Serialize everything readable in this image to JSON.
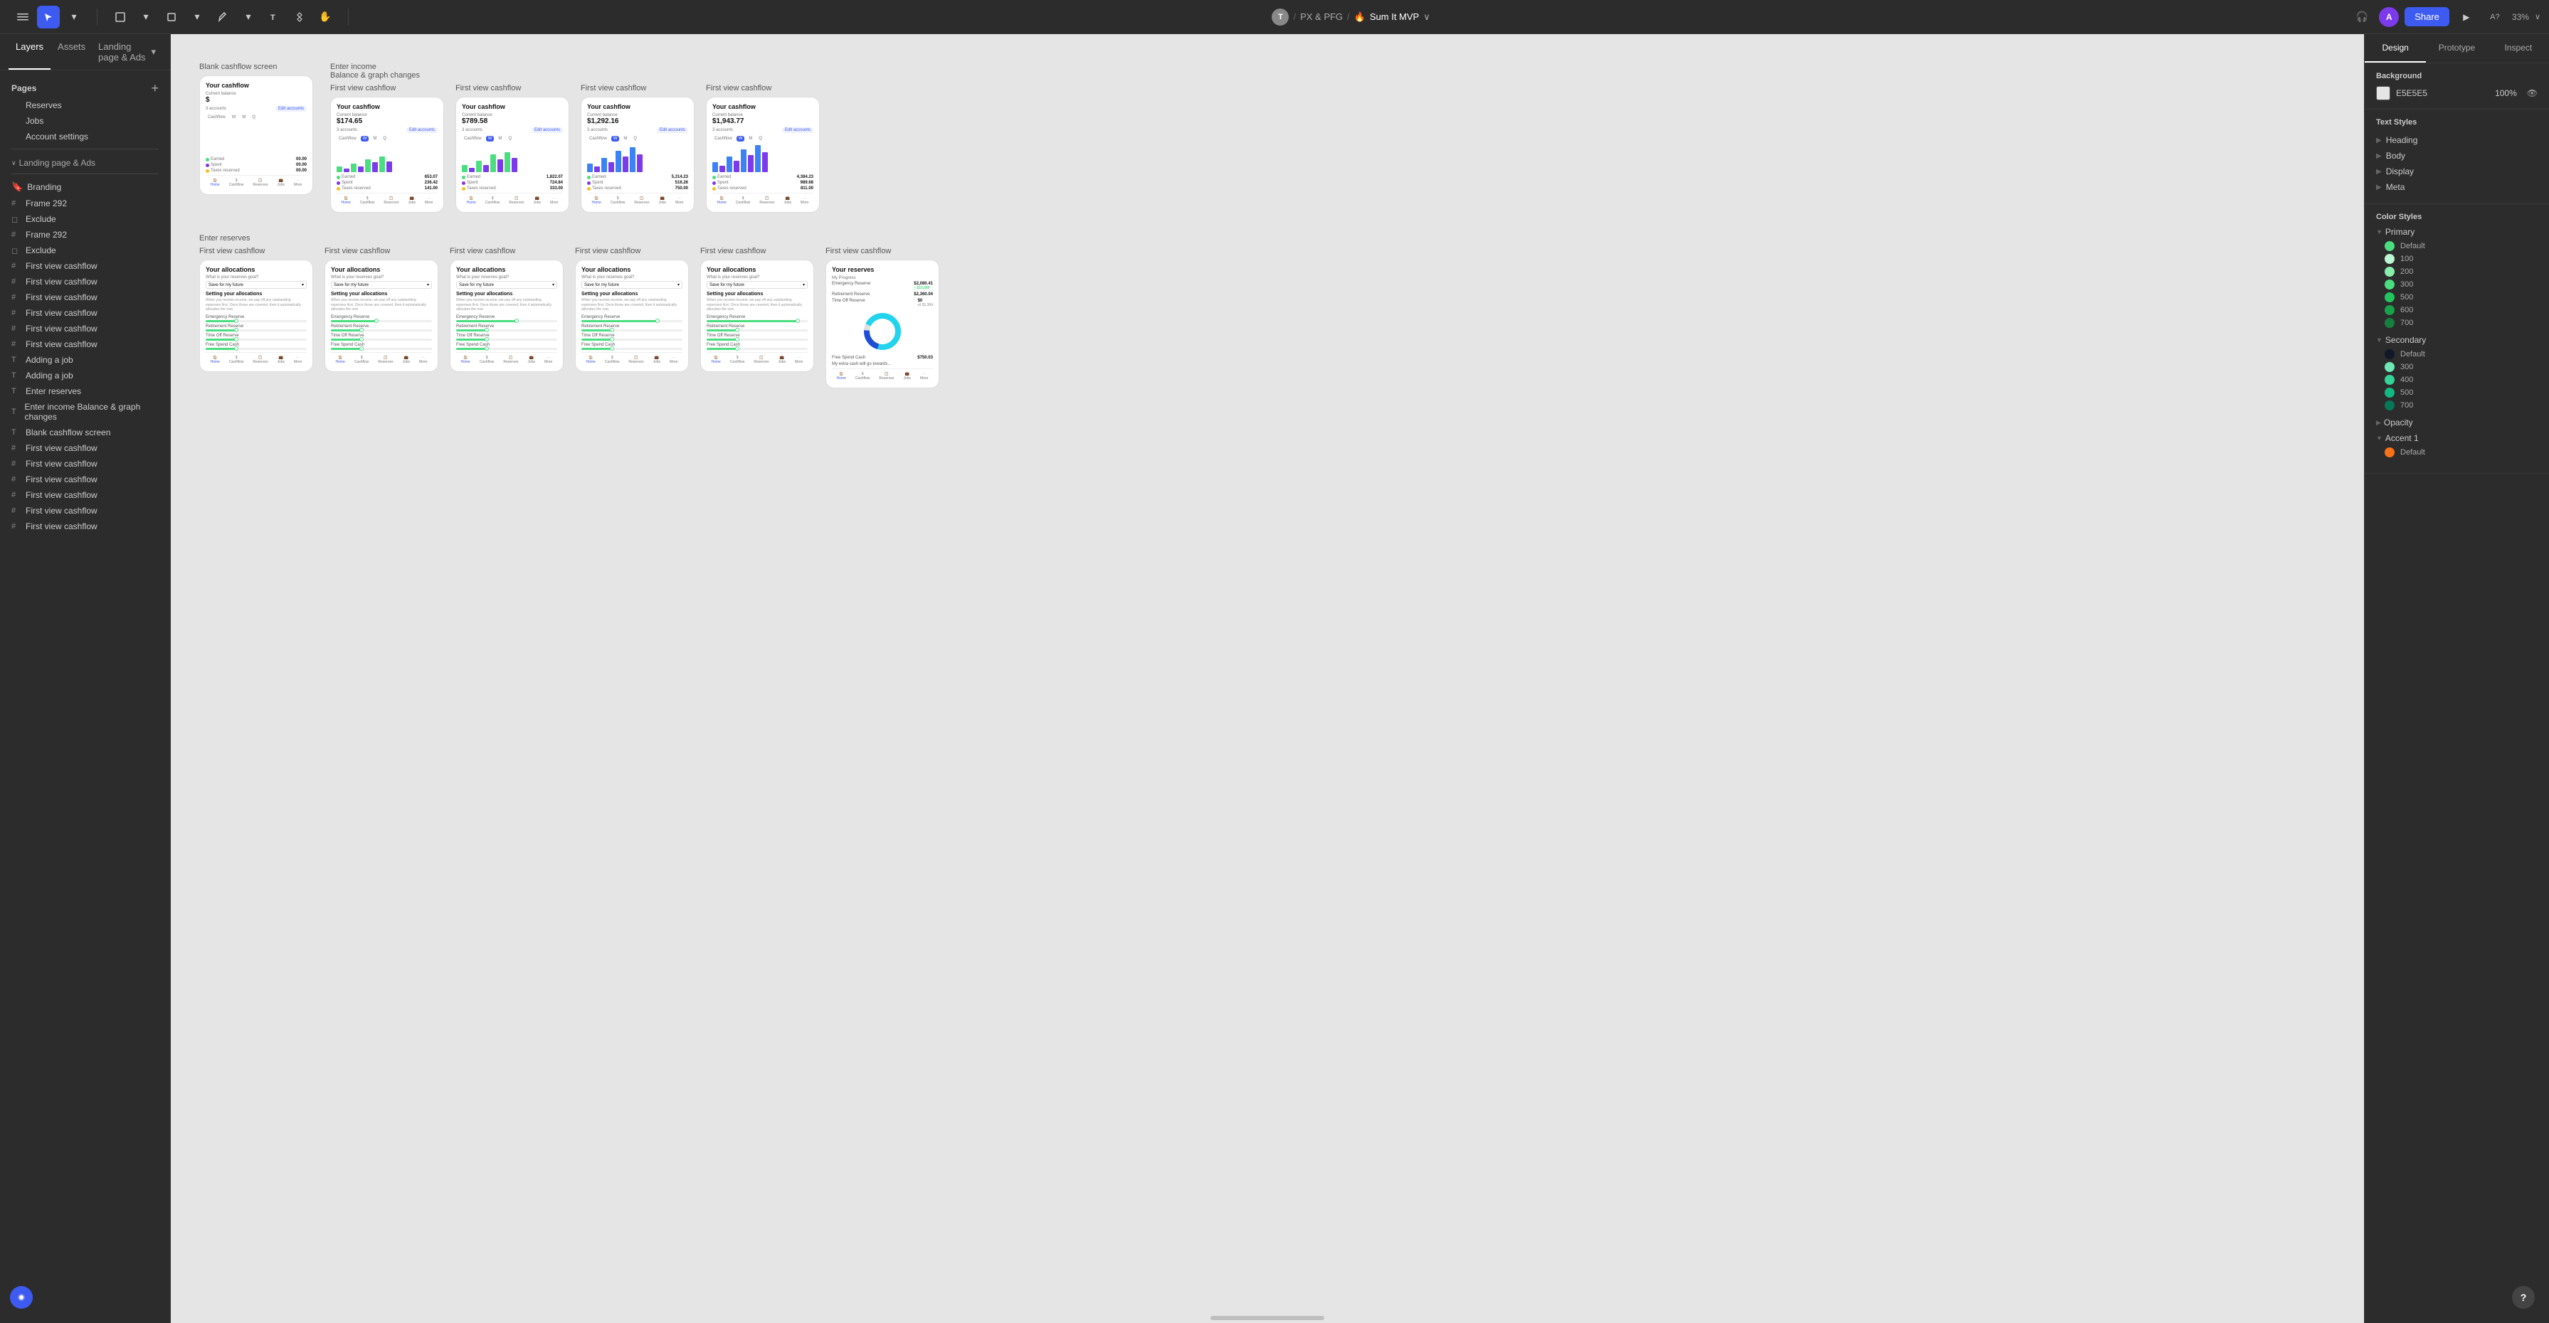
{
  "toolbar": {
    "avatar_initial": "T",
    "breadcrumb_sep": "/",
    "project_prefix": "PX & PFG",
    "fire_emoji": "🔥",
    "project_name": "Sum It MVP",
    "share_label": "Share",
    "play_icon": "▶",
    "zoom": "33%",
    "chevron": "∨"
  },
  "left_panel": {
    "tabs": [
      "Layers",
      "Assets"
    ],
    "page_dropdown": "Landing page & Ads",
    "pages_title": "Pages",
    "pages": [
      {
        "name": "Reserves",
        "icon": ""
      },
      {
        "name": "Jobs",
        "icon": ""
      },
      {
        "name": "Account settings",
        "icon": ""
      }
    ],
    "groups": [
      {
        "name": "Landing page & Ads",
        "expanded": true,
        "items": []
      }
    ],
    "branding": "🔖 Branding",
    "layers": [
      {
        "name": "Frame 292",
        "icon": "#",
        "type": "frame"
      },
      {
        "name": "Exclude",
        "icon": "◻",
        "type": "shape"
      },
      {
        "name": "First view cashflow",
        "icon": "#",
        "type": "frame"
      },
      {
        "name": "First view cashflow",
        "icon": "#",
        "type": "frame"
      },
      {
        "name": "First view cashflow",
        "icon": "#",
        "type": "frame"
      },
      {
        "name": "First view cashflow",
        "icon": "#",
        "type": "frame"
      },
      {
        "name": "First view cashflow",
        "icon": "#",
        "type": "frame"
      },
      {
        "name": "First view cashflow",
        "icon": "#",
        "type": "frame"
      },
      {
        "name": "Adding a job",
        "icon": "T",
        "type": "text"
      },
      {
        "name": "Adding a job",
        "icon": "T",
        "type": "text"
      },
      {
        "name": "Enter reserves",
        "icon": "T",
        "type": "text"
      },
      {
        "name": "Enter income Balance & graph changes",
        "icon": "T",
        "type": "text"
      },
      {
        "name": "Blank cashflow screen",
        "icon": "T",
        "type": "text"
      },
      {
        "name": "First view cashflow",
        "icon": "#",
        "type": "frame"
      },
      {
        "name": "First view cashflow",
        "icon": "#",
        "type": "frame"
      },
      {
        "name": "First view cashflow",
        "icon": "#",
        "type": "frame"
      },
      {
        "name": "First view cashflow",
        "icon": "#",
        "type": "frame"
      },
      {
        "name": "First view cashflow",
        "icon": "#",
        "type": "frame"
      },
      {
        "name": "First view cashflow",
        "icon": "#",
        "type": "frame"
      }
    ]
  },
  "canvas": {
    "row1_label": "Blank cashflow screen",
    "row1_label2": "Enter income\nBalance & graph changes",
    "section1_label": "First view cashflow",
    "frames_row1": [
      {
        "balance_label": "",
        "balance_amount": "$",
        "has_chart": false
      },
      {
        "balance_label": "Current balance",
        "balance_amount": "$174.65",
        "has_chart": true
      },
      {
        "balance_label": "Current balance",
        "balance_amount": "$789.58",
        "has_chart": true
      },
      {
        "balance_label": "Current balance",
        "balance_amount": "$1,292.16",
        "has_chart": true
      },
      {
        "balance_label": "Current balance",
        "balance_amount": "$1,943.77",
        "has_chart": true
      }
    ],
    "row2_label": "Enter reserves",
    "section2_label": "First view cashflow",
    "frames_row2_labels": [
      "",
      "",
      "",
      "",
      "",
      ""
    ],
    "allocations_frames": [
      "Your allocations",
      "Your allocations",
      "Your allocations",
      "Your allocations",
      "Your allocations",
      "Your reserves"
    ]
  },
  "right_panel": {
    "tabs": [
      "Design",
      "Prototype",
      "Inspect"
    ],
    "active_tab": "Design",
    "background": {
      "title": "Background",
      "color": "E5E5E5",
      "opacity": "100%"
    },
    "text_styles": {
      "title": "Text Styles",
      "items": [
        "Heading",
        "Body",
        "Display",
        "Meta"
      ]
    },
    "color_styles": {
      "title": "Color Styles",
      "groups": [
        {
          "name": "Primary",
          "expanded": true,
          "items": [
            {
              "name": "Default",
              "color": "#4ade80"
            },
            {
              "name": "100",
              "color": "#bbf7d0"
            },
            {
              "name": "200",
              "color": "#86efac"
            },
            {
              "name": "300",
              "color": "#4ade80"
            },
            {
              "name": "500",
              "color": "#22c55e"
            },
            {
              "name": "600",
              "color": "#16a34a"
            },
            {
              "name": "700",
              "color": "#15803d"
            }
          ]
        },
        {
          "name": "Secondary",
          "expanded": true,
          "items": [
            {
              "name": "Default",
              "color": "#111827"
            },
            {
              "name": "300",
              "color": "#6ee7b7"
            },
            {
              "name": "400",
              "color": "#34d399"
            },
            {
              "name": "500",
              "color": "#10b981"
            },
            {
              "name": "700",
              "color": "#047857"
            }
          ]
        },
        {
          "name": "Opacity",
          "expanded": false,
          "items": []
        },
        {
          "name": "Accent 1",
          "expanded": true,
          "items": [
            {
              "name": "Default",
              "color": "#f97316"
            }
          ]
        }
      ]
    }
  }
}
